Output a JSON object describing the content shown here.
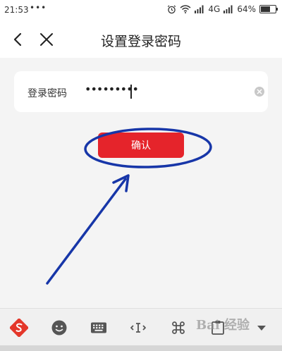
{
  "status_bar": {
    "time": "21:53",
    "dots": "•••",
    "network": "4G",
    "battery": "64%",
    "battery_level": 0.64
  },
  "header": {
    "title": "设置登录密码"
  },
  "password_field": {
    "label": "登录密码",
    "value": "•••••••••"
  },
  "confirm_button": {
    "label": "确认"
  },
  "watermark": {
    "text": "Bai 经验"
  },
  "colors": {
    "accent": "#e5242b",
    "annotation": "#1736a8",
    "sogou": "#e4372a"
  },
  "keyboard_toolbar": {
    "icons": [
      "sogou-logo-icon",
      "emoji-icon",
      "keyboard-icon",
      "cursor-move-icon",
      "command-icon",
      "clipboard-icon",
      "collapse-icon"
    ]
  }
}
